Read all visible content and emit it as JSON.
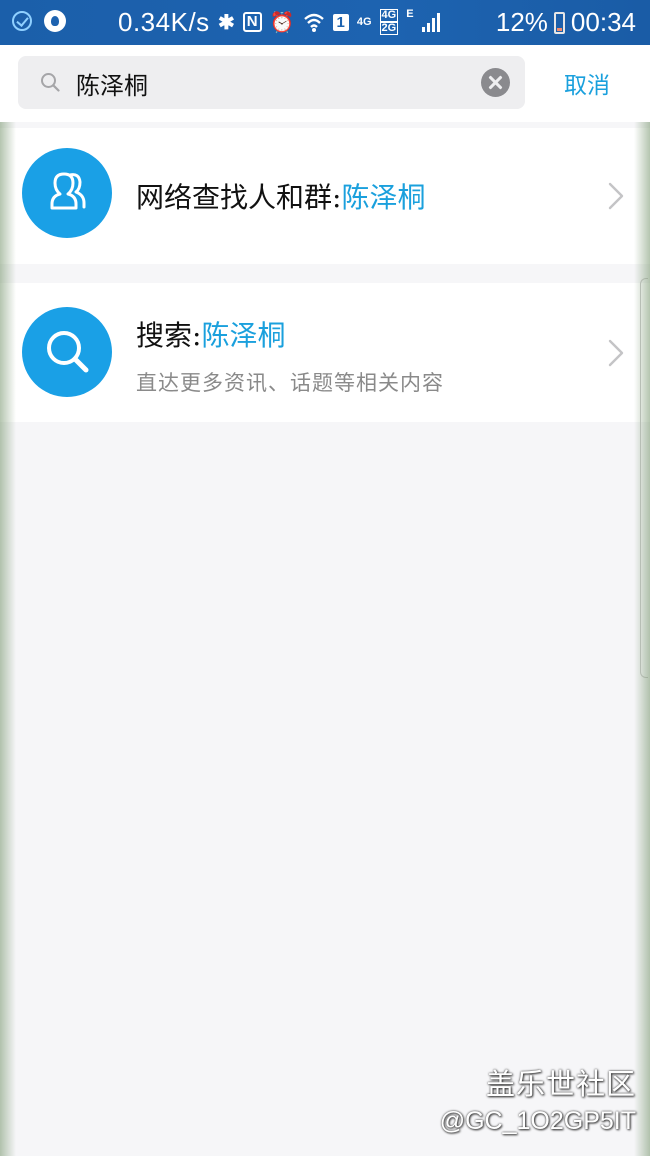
{
  "status_bar": {
    "net_speed": "0.34K/s",
    "sim_label": "1",
    "network_4g": "4G",
    "network_4g2g_top": "4G",
    "network_4g2g_bottom": "2G",
    "network_e": "E",
    "battery_percent": "12%",
    "time": "00:34",
    "nfc_label": "N"
  },
  "search": {
    "query": "陈泽桐",
    "cancel_label": "取消"
  },
  "results": [
    {
      "title_prefix": "网络查找人和群:",
      "title_highlight": "陈泽桐",
      "icon": "people-icon"
    },
    {
      "title_prefix": "搜索:",
      "title_highlight": "陈泽桐",
      "subtitle": "直达更多资讯、话题等相关内容",
      "icon": "search-icon"
    }
  ],
  "watermark": {
    "brand": "盖乐世社区",
    "user": "@GC_1O2GP5IT"
  },
  "colors": {
    "accent": "#1aa0dd",
    "avatar_bg": "#1aa0e6",
    "status_bar": "#1d63b0",
    "background": "#f6f6f8"
  }
}
